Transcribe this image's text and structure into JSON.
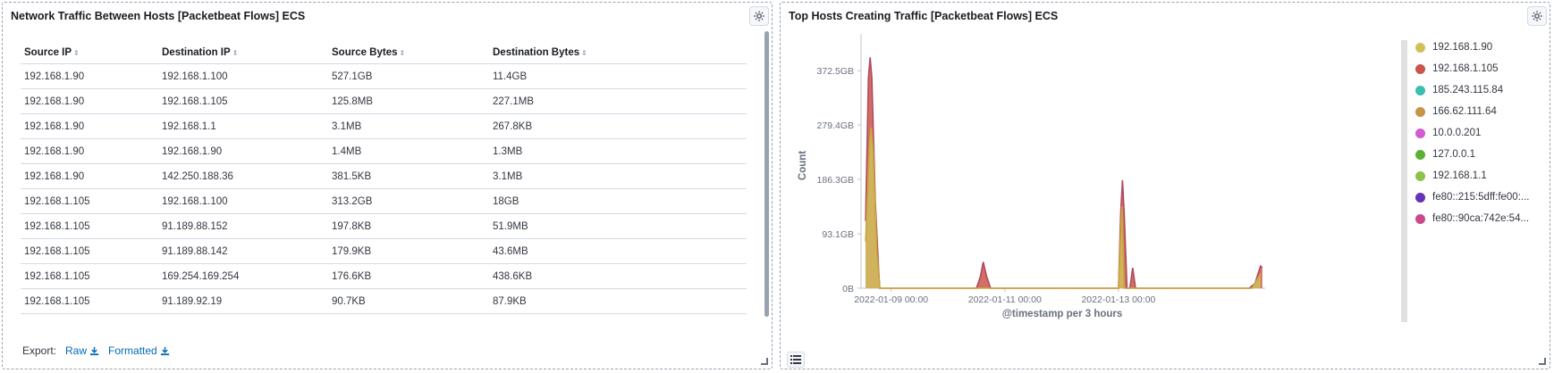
{
  "left_panel": {
    "title": "Network Traffic Between Hosts [Packetbeat Flows] ECS",
    "columns": [
      "Source IP",
      "Destination IP",
      "Source Bytes",
      "Destination Bytes"
    ],
    "rows": [
      [
        "192.168.1.90",
        "192.168.1.100",
        "527.1GB",
        "11.4GB"
      ],
      [
        "192.168.1.90",
        "192.168.1.105",
        "125.8MB",
        "227.1MB"
      ],
      [
        "192.168.1.90",
        "192.168.1.1",
        "3.1MB",
        "267.8KB"
      ],
      [
        "192.168.1.90",
        "192.168.1.90",
        "1.4MB",
        "1.3MB"
      ],
      [
        "192.168.1.90",
        "142.250.188.36",
        "381.5KB",
        "3.1MB"
      ],
      [
        "192.168.1.105",
        "192.168.1.100",
        "313.2GB",
        "18GB"
      ],
      [
        "192.168.1.105",
        "91.189.88.152",
        "197.8KB",
        "51.9MB"
      ],
      [
        "192.168.1.105",
        "91.189.88.142",
        "179.9KB",
        "43.6MB"
      ],
      [
        "192.168.1.105",
        "169.254.169.254",
        "176.6KB",
        "438.6KB"
      ],
      [
        "192.168.1.105",
        "91.189.92.19",
        "90.7KB",
        "87.9KB"
      ]
    ],
    "export_label": "Export:",
    "raw_label": "Raw",
    "formatted_label": "Formatted"
  },
  "right_panel": {
    "title": "Top Hosts Creating Traffic [Packetbeat Flows] ECS",
    "legend": [
      {
        "label": "192.168.1.90",
        "color": "#d0c05a"
      },
      {
        "label": "192.168.1.105",
        "color": "#c9564a"
      },
      {
        "label": "185.243.115.84",
        "color": "#3ebeb0"
      },
      {
        "label": "166.62.111.64",
        "color": "#c8944a"
      },
      {
        "label": "10.0.0.201",
        "color": "#d25ccf"
      },
      {
        "label": "127.0.0.1",
        "color": "#5cb135"
      },
      {
        "label": "192.168.1.1",
        "color": "#8ec14d"
      },
      {
        "label": "fe80::215:5dff:fe00:...",
        "color": "#6634b4"
      },
      {
        "label": "fe80::90ca:742e:54...",
        "color": "#c94a8c"
      }
    ]
  },
  "chart_data": {
    "type": "area",
    "title": "Top Hosts Creating Traffic [Packetbeat Flows] ECS",
    "xlabel": "@timestamp per 3 hours",
    "ylabel": "Count",
    "x_ticks": [
      "2022-01-09 00:00",
      "2022-01-11 00:00",
      "2022-01-13 00:00"
    ],
    "y_ticks": [
      "0B",
      "93.1GB",
      "186.3GB",
      "279.4GB",
      "372.5GB"
    ],
    "y_unit": "GB",
    "ylim": [
      0,
      420
    ],
    "xlim_days": [
      8.47,
      15.55
    ],
    "series": [
      {
        "name": "192.168.1.90",
        "color": "#d0c05a",
        "line": "#c8a83c",
        "points": [
          [
            8.55,
            80
          ],
          [
            8.62,
            250
          ],
          [
            8.65,
            275
          ],
          [
            8.68,
            240
          ],
          [
            8.75,
            60
          ],
          [
            8.8,
            0
          ],
          [
            13.0,
            0
          ],
          [
            13.06,
            140
          ],
          [
            13.1,
            0
          ],
          [
            15.35,
            0
          ],
          [
            15.5,
            25
          ]
        ]
      },
      {
        "name": "192.168.1.105",
        "color": "#c9564a",
        "line": "#b24a5e",
        "points": [
          [
            8.55,
            115
          ],
          [
            8.6,
            360
          ],
          [
            8.63,
            395
          ],
          [
            8.66,
            360
          ],
          [
            8.72,
            150
          ],
          [
            8.78,
            30
          ],
          [
            8.8,
            0
          ],
          [
            10.5,
            0
          ],
          [
            10.57,
            20
          ],
          [
            10.62,
            45
          ],
          [
            10.68,
            20
          ],
          [
            10.75,
            0
          ],
          [
            13.0,
            0
          ],
          [
            13.04,
            130
          ],
          [
            13.07,
            185
          ],
          [
            13.1,
            130
          ],
          [
            13.15,
            0
          ],
          [
            13.2,
            0
          ],
          [
            13.25,
            35
          ],
          [
            13.3,
            0
          ],
          [
            15.3,
            0
          ],
          [
            15.4,
            8
          ],
          [
            15.5,
            38
          ],
          [
            15.53,
            35
          ]
        ]
      }
    ]
  }
}
